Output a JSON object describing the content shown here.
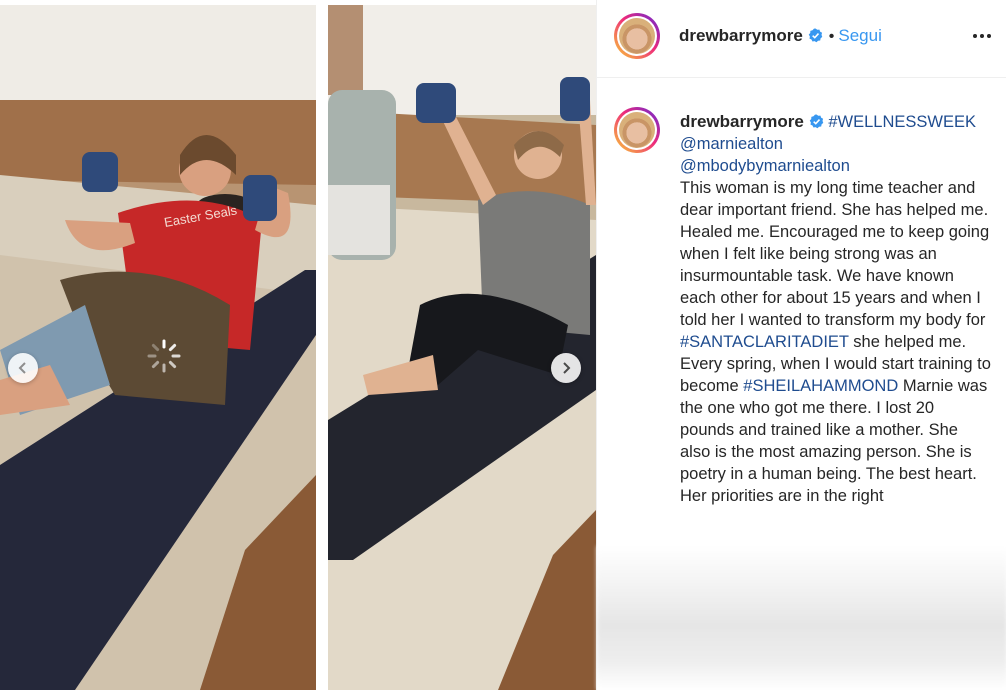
{
  "post": {
    "username": "drewbarrymore",
    "follow_label": "Segui",
    "separator": "•"
  },
  "caption": {
    "username": "drewbarrymore",
    "hashtag_wellness": "#WELLNESSWEEK",
    "mention_1": "@marniealton",
    "mention_2": "@mbodybymarniealton",
    "text_1": "This woman is my long time teacher and dear important friend. She has helped me. Healed me. Encouraged me to keep going when I felt like being strong was an insurmountable task. We have known each other for about 15 years and when I told her I wanted to transform my body for ",
    "hashtag_santaclarita": "#SANTACLARITADIET",
    "text_2": " she helped me. Every spring, when I would start training to become ",
    "hashtag_sheila": "#SHEILAHAMMOND",
    "text_3": " Marnie was the one who got me there. I lost 20 pounds and trained like a mother. She also is the most amazing person. She is poetry in a human being. The best heart. Her priorities are in the right"
  },
  "icons": {
    "verified": "verified-badge-icon",
    "more": "more-options-icon",
    "prev": "chevron-left-icon",
    "next": "chevron-right-icon",
    "loading": "loading-spinner-icon"
  },
  "colors": {
    "link": "#1f4c8f",
    "follow": "#3897f0",
    "text": "#262626",
    "verified": "#3897f0"
  }
}
